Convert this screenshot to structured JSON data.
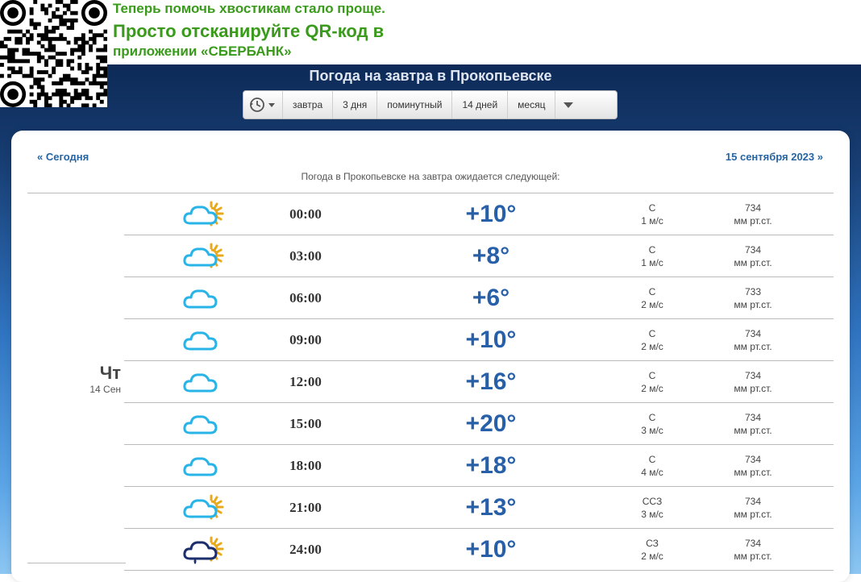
{
  "banner": {
    "line1": "Теперь помочь хвостикам стало проще.",
    "line2": "Просто отсканируйте QR-код в",
    "line3": "приложении «СБЕРБАНК»"
  },
  "page_title": "Погода на завтра в Прокопьевске",
  "navbar": {
    "history_icon": "history-icon",
    "items": [
      "завтра",
      "3 дня",
      "поминутный",
      "14 дней",
      "месяц"
    ],
    "more_icon": "chevron-down-icon"
  },
  "nav": {
    "prev": "« Сегодня",
    "next": "15 сентября 2023 »"
  },
  "intro": "Погода в Прокопьевске на завтра ожидается следующей:",
  "day": {
    "weekday": "Чт",
    "date": "14 Сен"
  },
  "colors": {
    "temp": "#2760a8",
    "cloud": "#29b4e8",
    "sun": "#e8a91c",
    "link": "#2664a3"
  },
  "rows": [
    {
      "time": "00:00",
      "temp": "+10°",
      "icon": "partly-cloudy-icon",
      "wind_dir": "С",
      "wind_speed": "1 м/с",
      "pressure": "734",
      "pressure_unit": "мм рт.ст."
    },
    {
      "time": "03:00",
      "temp": "+8°",
      "icon": "partly-cloudy-icon",
      "wind_dir": "С",
      "wind_speed": "1 м/с",
      "pressure": "734",
      "pressure_unit": "мм рт.ст."
    },
    {
      "time": "06:00",
      "temp": "+6°",
      "icon": "cloud-icon",
      "wind_dir": "С",
      "wind_speed": "2 м/с",
      "pressure": "733",
      "pressure_unit": "мм рт.ст."
    },
    {
      "time": "09:00",
      "temp": "+10°",
      "icon": "cloud-icon",
      "wind_dir": "С",
      "wind_speed": "2 м/с",
      "pressure": "734",
      "pressure_unit": "мм рт.ст."
    },
    {
      "time": "12:00",
      "temp": "+16°",
      "icon": "cloud-icon",
      "wind_dir": "С",
      "wind_speed": "2 м/с",
      "pressure": "734",
      "pressure_unit": "мм рт.ст."
    },
    {
      "time": "15:00",
      "temp": "+20°",
      "icon": "cloud-icon",
      "wind_dir": "С",
      "wind_speed": "3 м/с",
      "pressure": "734",
      "pressure_unit": "мм рт.ст."
    },
    {
      "time": "18:00",
      "temp": "+18°",
      "icon": "cloud-icon",
      "wind_dir": "С",
      "wind_speed": "4 м/с",
      "pressure": "734",
      "pressure_unit": "мм рт.ст."
    },
    {
      "time": "21:00",
      "temp": "+13°",
      "icon": "partly-cloudy-icon",
      "wind_dir": "ССЗ",
      "wind_speed": "3 м/с",
      "pressure": "734",
      "pressure_unit": "мм рт.ст."
    },
    {
      "time": "24:00",
      "temp": "+10°",
      "icon": "rain-sun-icon",
      "wind_dir": "СЗ",
      "wind_speed": "2 м/с",
      "pressure": "734",
      "pressure_unit": "мм рт.ст."
    }
  ]
}
